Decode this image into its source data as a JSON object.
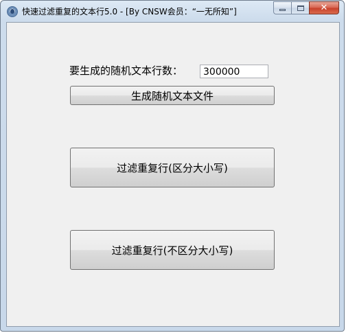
{
  "window": {
    "title": "快速过滤重复的文本行5.0 - [By CNSW会员：“一无所知”]",
    "icon": "app-icon"
  },
  "caption": {
    "minimize_icon": "minimize-icon",
    "maximize_icon": "maximize-icon",
    "close_glyph": "✕"
  },
  "form": {
    "row_count_label": "要生成的随机文本行数：",
    "row_count_value": "300000"
  },
  "buttons": {
    "generate": "生成随机文本文件",
    "filter_case_sensitive": "过滤重复行(区分大小写)",
    "filter_case_insensitive": "过滤重复行(不区分大小写)"
  },
  "colors": {
    "client_bg": "#f0f0f0",
    "close_button": "#c7402a"
  }
}
